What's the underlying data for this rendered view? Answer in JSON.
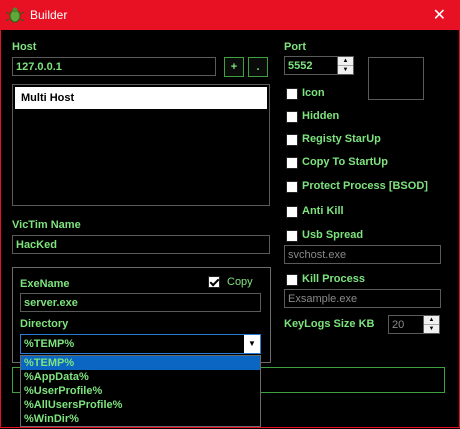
{
  "window": {
    "title": "Builder",
    "close_glyph": "✕",
    "icon": "bug-icon"
  },
  "host": {
    "label": "Host",
    "value": "127.0.0.1",
    "add_label": "+",
    "remove_label": "."
  },
  "host_list": [
    "Multi Host"
  ],
  "port": {
    "label": "Port",
    "value": "5552"
  },
  "victim": {
    "label": "VicTim Name",
    "value": "HacKed"
  },
  "exe": {
    "label": "ExeName",
    "value": "server.exe",
    "copy_label": "Copy",
    "copy_checked": true
  },
  "directory": {
    "label": "Directory",
    "selected": "%TEMP%",
    "options": [
      "%TEMP%",
      "%AppData%",
      "%UserProfile%",
      "%AllUsersProfile%",
      "%WinDir%"
    ]
  },
  "options": {
    "icon": "Icon",
    "hidden": "Hidden",
    "registry_startup": "Registy StarUp",
    "copy_to_startup": "Copy To StartUp",
    "protect_process": "Protect Process [BSOD]",
    "anti_kill": "Anti Kill",
    "usb_spread": "Usb Spread",
    "usb_exe": "svchost.exe",
    "kill_process": "Kill Process",
    "kill_exe": "Exsample.exe",
    "keylogs_label": "KeyLogs Size KB",
    "keylogs_value": "20"
  },
  "colors": {
    "title_bar": "#e81123",
    "text": "#7ee37e",
    "background": "#000000",
    "selection": "#0a66c2"
  }
}
